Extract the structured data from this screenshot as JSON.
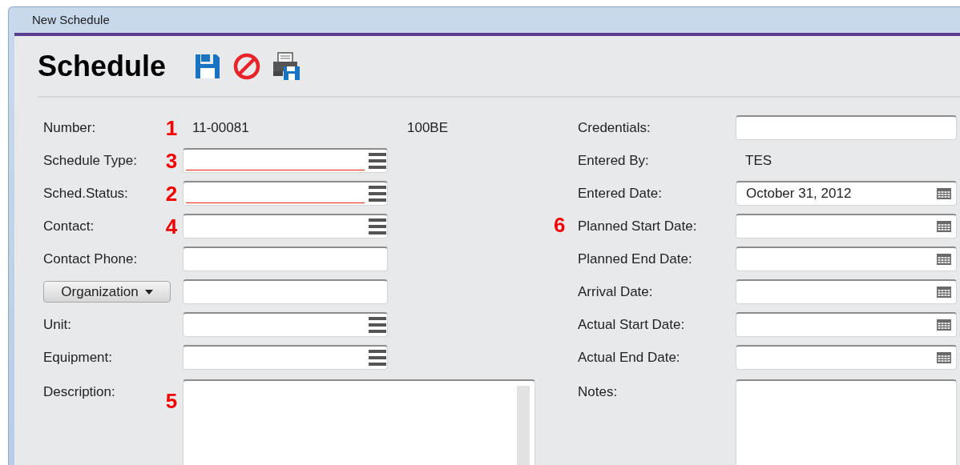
{
  "window": {
    "title": "New Schedule"
  },
  "heading": "Schedule",
  "toolbar": [
    {
      "kind": "save"
    },
    {
      "kind": "cancel"
    },
    {
      "kind": "print"
    }
  ],
  "left_fields": [
    {
      "label": "Number:",
      "marker": "1",
      "kind": "static",
      "value": "11-00081",
      "extra": "100BE"
    },
    {
      "label": "Schedule Type:",
      "marker": "3",
      "kind": "lookup",
      "required": true
    },
    {
      "label": "Sched.Status:",
      "marker": "2",
      "kind": "lookup",
      "required": true
    },
    {
      "label": "Contact:",
      "marker": "4",
      "kind": "lookup",
      "required": false
    },
    {
      "label": "Contact Phone:",
      "kind": "text"
    },
    {
      "label": "Organization",
      "kind": "dropdown_text"
    },
    {
      "label": "Unit:",
      "kind": "lookup",
      "required": false
    },
    {
      "label": "Equipment:",
      "kind": "lookup",
      "required": false
    },
    {
      "label": "Description:",
      "marker": "5",
      "kind": "textarea"
    }
  ],
  "right_fields": [
    {
      "label": "Credentials:",
      "kind": "text"
    },
    {
      "label": "Entered By:",
      "kind": "static",
      "value": "TES"
    },
    {
      "label": "Entered Date:",
      "kind": "date",
      "value": "October 31, 2012"
    },
    {
      "label": "Planned Start Date:",
      "marker": "6",
      "kind": "date"
    },
    {
      "label": "Planned End Date:",
      "kind": "date"
    },
    {
      "label": "Arrival Date:",
      "kind": "date"
    },
    {
      "label": "Actual Start Date:",
      "kind": "date"
    },
    {
      "label": "Actual End Date:",
      "kind": "date"
    },
    {
      "label": "Notes:",
      "kind": "textarea"
    }
  ]
}
